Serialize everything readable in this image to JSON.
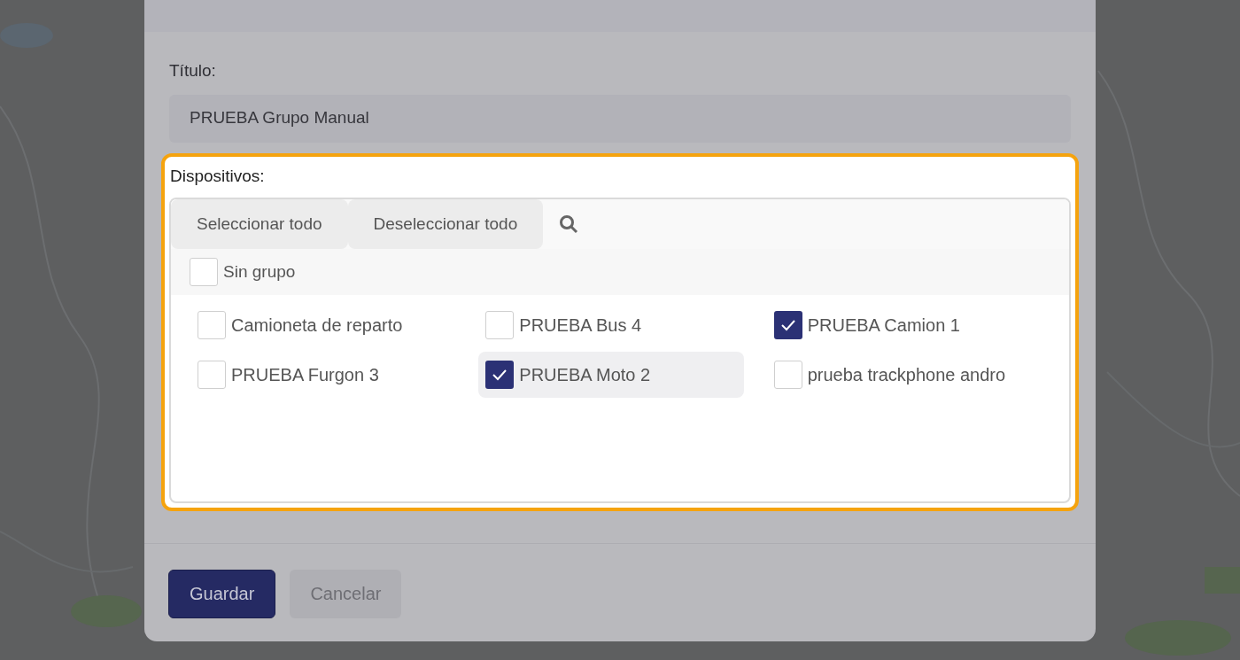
{
  "form": {
    "title_label": "Título:",
    "title_value": "PRUEBA Grupo Manual"
  },
  "devices": {
    "label": "Dispositivos:",
    "toolbar": [
      {
        "kind": "button",
        "label": "Seleccionar todo"
      },
      {
        "kind": "button",
        "label": "Deseleccionar todo"
      },
      {
        "kind": "search"
      }
    ],
    "group": {
      "label": "Sin grupo",
      "checked": false
    },
    "items": [
      {
        "label": "Camioneta de reparto",
        "checked": false,
        "highlighted": false
      },
      {
        "label": "PRUEBA Bus 4",
        "checked": false,
        "highlighted": false
      },
      {
        "label": "PRUEBA Camion 1",
        "checked": true,
        "highlighted": false
      },
      {
        "label": "PRUEBA Furgon 3",
        "checked": false,
        "highlighted": false
      },
      {
        "label": "PRUEBA Moto 2",
        "checked": true,
        "highlighted": true
      },
      {
        "label": "prueba trackphone andro",
        "checked": false,
        "highlighted": false
      }
    ]
  },
  "buttons": [
    {
      "kind": "primary",
      "label": "Guardar"
    },
    {
      "kind": "secondary",
      "label": "Cancelar"
    }
  ]
}
